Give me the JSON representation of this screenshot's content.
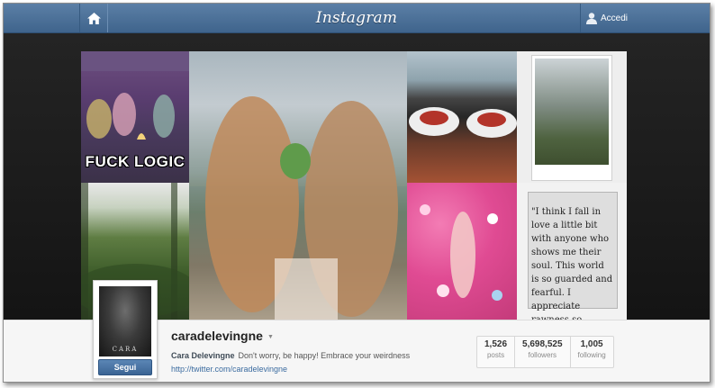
{
  "header": {
    "brand": "Instagram",
    "login_label": "Accedi"
  },
  "grid": {
    "meme_text": "FUCK LOGIC",
    "quote_text": "\"I think I fall in love a little bit with anyone who shows me their soul. This world is so guarded and fearful. I appreciate rawness so much.\""
  },
  "profile": {
    "avatar_text": "CARA",
    "follow_label": "Segui",
    "username": "caradelevingne",
    "full_name": "Cara Delevingne",
    "bio": "Don't worry, be happy! Embrace your weirdness",
    "website": "http://twitter.com/caradelevingne",
    "stats": [
      {
        "value": "1,526",
        "label": "posts"
      },
      {
        "value": "5,698,525",
        "label": "followers"
      },
      {
        "value": "1,005",
        "label": "following"
      }
    ]
  },
  "colors": {
    "topbar": "#4a6f97",
    "link": "#3c6ca0",
    "follow_button": "#4a74a5"
  }
}
